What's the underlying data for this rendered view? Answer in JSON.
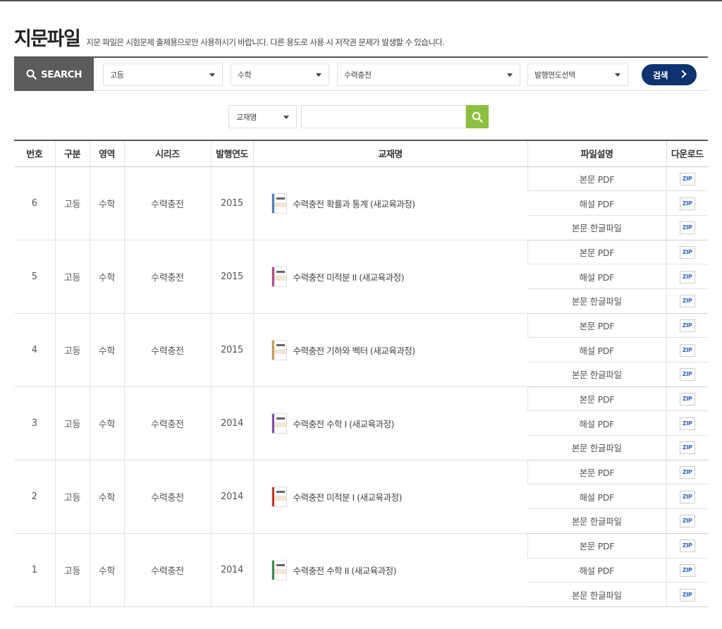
{
  "page": {
    "title": "지문파일",
    "subtitle": "지문 파일은 시험문제 출제용으로만 사용하시기 바랍니다. 다른 용도로 사용 시 저작권 문제가 발생할 수 있습니다."
  },
  "search": {
    "label": "SEARCH",
    "level": "고등",
    "subject": "수학",
    "series": "수력충전",
    "year": "발행연도선택",
    "submit": "검색",
    "book_field": "교재명",
    "book_input_value": ""
  },
  "table": {
    "headers": [
      "번호",
      "구분",
      "영역",
      "시리즈",
      "발행연도",
      "교재명",
      "파일설명",
      "다운로드"
    ],
    "file_types": [
      "본문 PDF",
      "해설 PDF",
      "본문 한글파일"
    ],
    "download_label": "ZIP",
    "rows": [
      {
        "no": "6",
        "level": "고등",
        "area": "수학",
        "series": "수력충전",
        "year": "2015",
        "title": "수력충전 확률과 통계 (새교육과정)",
        "spine": "#4a7fb5"
      },
      {
        "no": "5",
        "level": "고등",
        "area": "수학",
        "series": "수력충전",
        "year": "2015",
        "title": "수력충전 미적분 II (새교육과정)",
        "spine": "#b0468f"
      },
      {
        "no": "4",
        "level": "고등",
        "area": "수학",
        "series": "수력충전",
        "year": "2015",
        "title": "수력충전 기하와 벡터 (새교육과정)",
        "spine": "#c89a5a"
      },
      {
        "no": "3",
        "level": "고등",
        "area": "수학",
        "series": "수력충전",
        "year": "2014",
        "title": "수력충전 수학 I (새교육과정)",
        "spine": "#7a4fa8"
      },
      {
        "no": "2",
        "level": "고등",
        "area": "수학",
        "series": "수력충전",
        "year": "2014",
        "title": "수력충전 미적분 I (새교육과정)",
        "spine": "#c0392b"
      },
      {
        "no": "1",
        "level": "고등",
        "area": "수학",
        "series": "수력충전",
        "year": "2014",
        "title": "수력충전 수학 II (새교육과정)",
        "spine": "#3a8a4f"
      }
    ]
  },
  "colors": {
    "search_label_bg": "#5c5c5c",
    "submit_bg": "#0f3270",
    "book_search_btn": "#8cbf3f"
  }
}
